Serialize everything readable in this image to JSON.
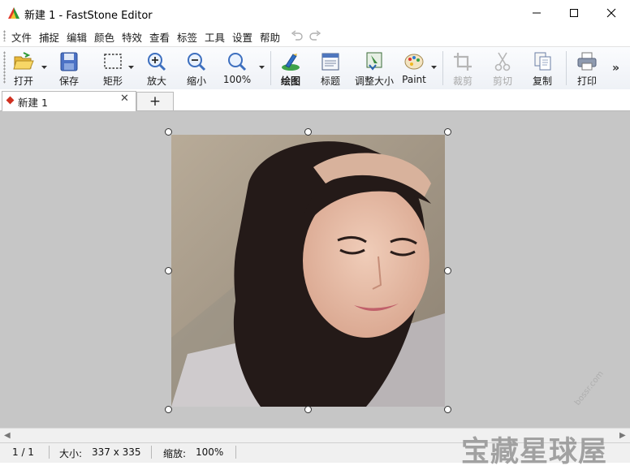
{
  "window": {
    "title": "新建 1 - FastStone Editor",
    "controls": {
      "minimize": "—",
      "maximize": "☐",
      "close": "✕"
    }
  },
  "menu": {
    "items": [
      "文件",
      "捕捉",
      "编辑",
      "颜色",
      "特效",
      "查看",
      "标签",
      "工具",
      "设置",
      "帮助"
    ]
  },
  "toolbar": {
    "buttons": [
      {
        "label": "打开",
        "icon": "open-folder-icon",
        "enabled": true
      },
      {
        "label": "保存",
        "icon": "save-icon",
        "enabled": true
      },
      {
        "label": "矩形",
        "icon": "rectangle-select-icon",
        "enabled": true
      },
      {
        "label": "放大",
        "icon": "zoom-in-icon",
        "enabled": true
      },
      {
        "label": "缩小",
        "icon": "zoom-out-icon",
        "enabled": true
      },
      {
        "label": "100%",
        "icon": "zoom-actual-icon",
        "enabled": true
      },
      {
        "label": "绘图",
        "icon": "draw-icon",
        "enabled": true,
        "bold": true
      },
      {
        "label": "标题",
        "icon": "caption-icon",
        "enabled": true
      },
      {
        "label": "调整大小",
        "icon": "resize-icon",
        "enabled": true
      },
      {
        "label": "Paint",
        "icon": "paint-palette-icon",
        "enabled": true
      },
      {
        "label": "裁剪",
        "icon": "crop-icon",
        "enabled": false
      },
      {
        "label": "剪切",
        "icon": "cut-icon",
        "enabled": false
      },
      {
        "label": "复制",
        "icon": "copy-icon",
        "enabled": true
      },
      {
        "label": "打印",
        "icon": "print-icon",
        "enabled": true
      }
    ],
    "overflow": "»"
  },
  "tabs": {
    "document": {
      "label": "新建 1",
      "close": "✕"
    },
    "add": "+"
  },
  "status": {
    "page": "1 / 1",
    "size_label": "大小:",
    "size_value": "337 x 335",
    "zoom_label": "缩放:",
    "zoom_value": "100%"
  },
  "watermark": {
    "big": "宝藏星球屋",
    "small": "bossr.com"
  },
  "colors": {
    "canvas_bg": "#c6c6c6",
    "accent_red": "#d03020",
    "disabled_text": "#a8a8a8"
  }
}
